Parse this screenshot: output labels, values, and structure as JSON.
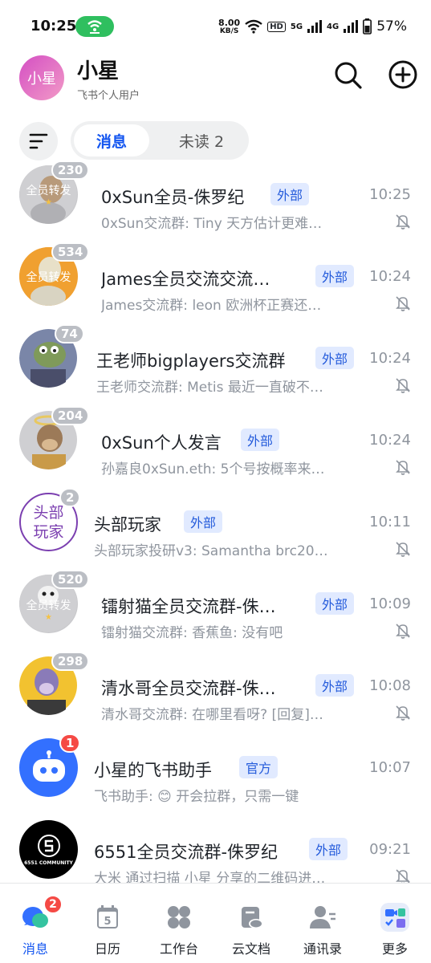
{
  "status_bar": {
    "time": "10:25",
    "net_speed_value": "8.00",
    "net_speed_unit": "KB/S",
    "hd": "HD",
    "sig1": "5G",
    "sig2": "4G",
    "battery": "57%"
  },
  "header": {
    "avatar_text": "小星",
    "name": "小星",
    "subtitle": "飞书个人用户"
  },
  "tabs": {
    "active": "消息",
    "unread": "未读 2"
  },
  "chats": [
    {
      "title": "0xSun全员-侏罗纪",
      "tag": "外部",
      "time": "10:25",
      "preview": "0xSun交流群: Tiny  天方估计更难…",
      "badge": "230",
      "avatar_text": "全员转发"
    },
    {
      "title": "James全员交流交流…",
      "tag": "外部",
      "time": "10:24",
      "preview": "James交流群: leon  欧洲杯正赛还…",
      "badge": "534",
      "avatar_text": "全员转发"
    },
    {
      "title": "王老师bigplayers交流群",
      "tag": "外部",
      "time": "10:24",
      "preview": "王老师交流群: Metis 最近一直破不…",
      "badge": "74"
    },
    {
      "title": "0xSun个人发言",
      "tag": "外部",
      "time": "10:24",
      "preview": "孙嘉良0xSun.eth: 5个号按概率来…",
      "badge": "204"
    },
    {
      "title": "头部玩家",
      "tag": "外部",
      "time": "10:11",
      "preview": "头部玩家投研v3: Samantha   brc20…",
      "badge": "2",
      "avatar_text": "头部玩家"
    },
    {
      "title": "镭射猫全员交流群-侏…",
      "tag": "外部",
      "time": "10:09",
      "preview": "镭射猫交流群: 香蕉鱼: 没有吧",
      "badge": "520",
      "avatar_text": "全员转发"
    },
    {
      "title": "清水哥全员交流群-侏…",
      "tag": "外部",
      "time": "10:08",
      "preview": "清水哥交流群: 在哪里看呀? [回复]…",
      "badge": "298"
    },
    {
      "title": "小星的飞书助手",
      "tag": "官方",
      "time": "10:07",
      "preview": "飞书助手: 😊 开会拉群，只需一键",
      "badge": "1"
    },
    {
      "title": "6551全员交流群-侏罗纪",
      "tag": "外部",
      "time": "09:21",
      "preview": "大米 通过扫描 小星 分享的二维码进…",
      "avatar_text": "6551 COMMUNITY"
    }
  ],
  "bottom_nav": [
    {
      "label": "消息",
      "badge": "2"
    },
    {
      "label": "日历",
      "day": "5"
    },
    {
      "label": "工作台"
    },
    {
      "label": "云文档"
    },
    {
      "label": "通讯录"
    },
    {
      "label": "更多"
    }
  ],
  "colors": {
    "accent": "#1456f0",
    "tag_bg": "#e1eaff",
    "badge_gray": "#bbbec4",
    "badge_red": "#f54a45"
  }
}
